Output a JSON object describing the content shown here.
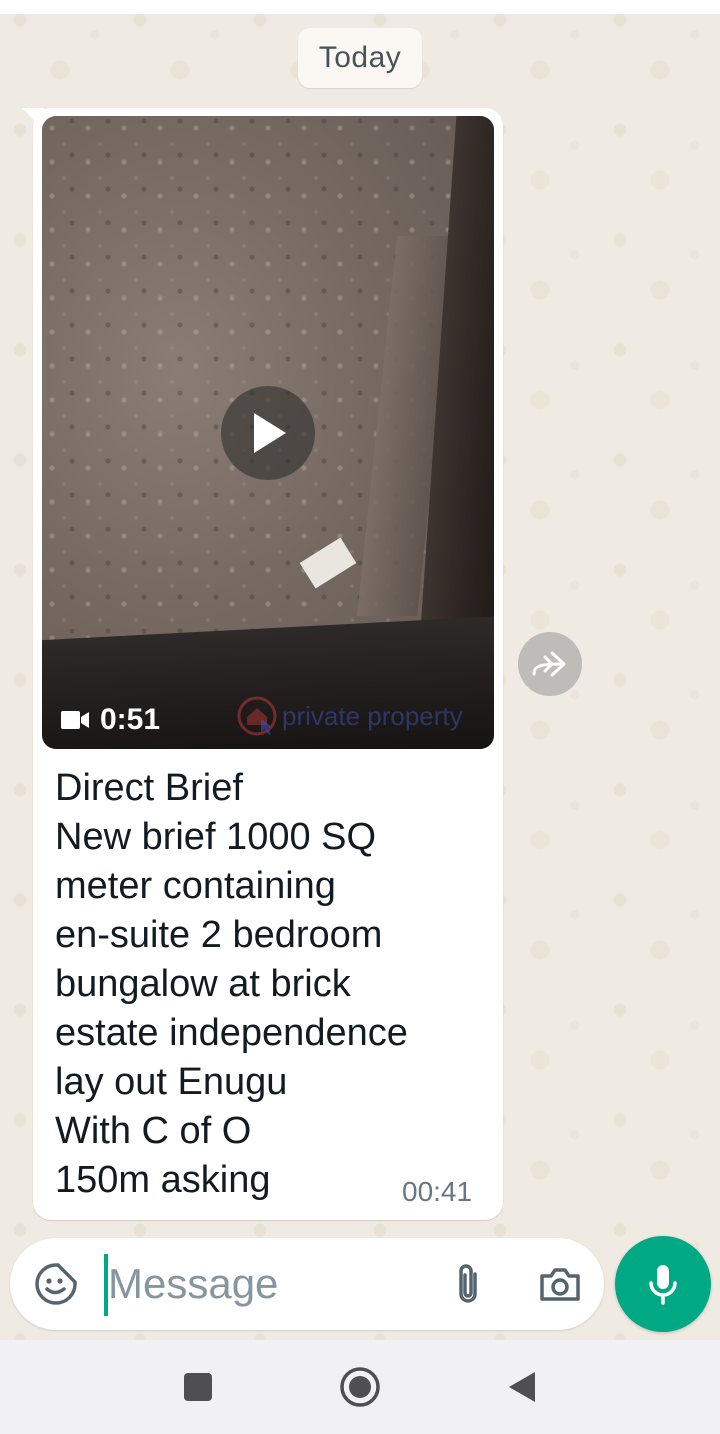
{
  "chat": {
    "date_label": "Today",
    "message": {
      "video_duration": "0:51",
      "watermark_text": "private property",
      "text": "Direct Brief\nNew brief 1000 SQ\nmeter containing\nen-suite 2 bedroom\nbungalow at brick\nestate independence\nlay out Enugu\nWith C of O\n150m asking",
      "time": "00:41"
    }
  },
  "composer": {
    "placeholder": "Message",
    "value": ""
  },
  "icons": {
    "play": "play-icon",
    "video_camera": "video-camera-icon",
    "forward": "forward-icon",
    "sticker": "sticker-icon",
    "attach": "paperclip-icon",
    "camera": "camera-icon",
    "mic": "microphone-icon",
    "nav_recents": "recents-square-icon",
    "nav_home": "home-circle-icon",
    "nav_back": "back-triangle-icon"
  },
  "colors": {
    "accent": "#00a884",
    "chat_background": "#efeae2",
    "bubble": "#ffffff",
    "text_primary": "#111b21",
    "text_meta": "#667781"
  }
}
